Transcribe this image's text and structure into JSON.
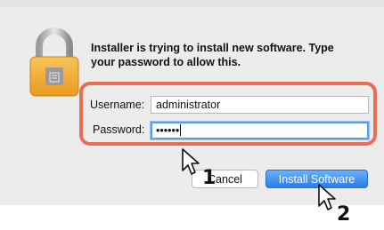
{
  "dialog": {
    "message": "Installer is trying to install new software. Type your password to allow this.",
    "lock_icon": "padlock-icon"
  },
  "credentials": {
    "username_label": "Username:",
    "username_value": "administrator",
    "password_label": "Password:",
    "password_value": "••••••"
  },
  "buttons": {
    "cancel_label": "Cancel",
    "install_label": "Install Software"
  },
  "annotations": {
    "step_1": "1",
    "step_2": "2",
    "highlight_color": "#ea6e51"
  },
  "colors": {
    "accent": "#2a7de8",
    "focus": "#5b9ee6"
  }
}
